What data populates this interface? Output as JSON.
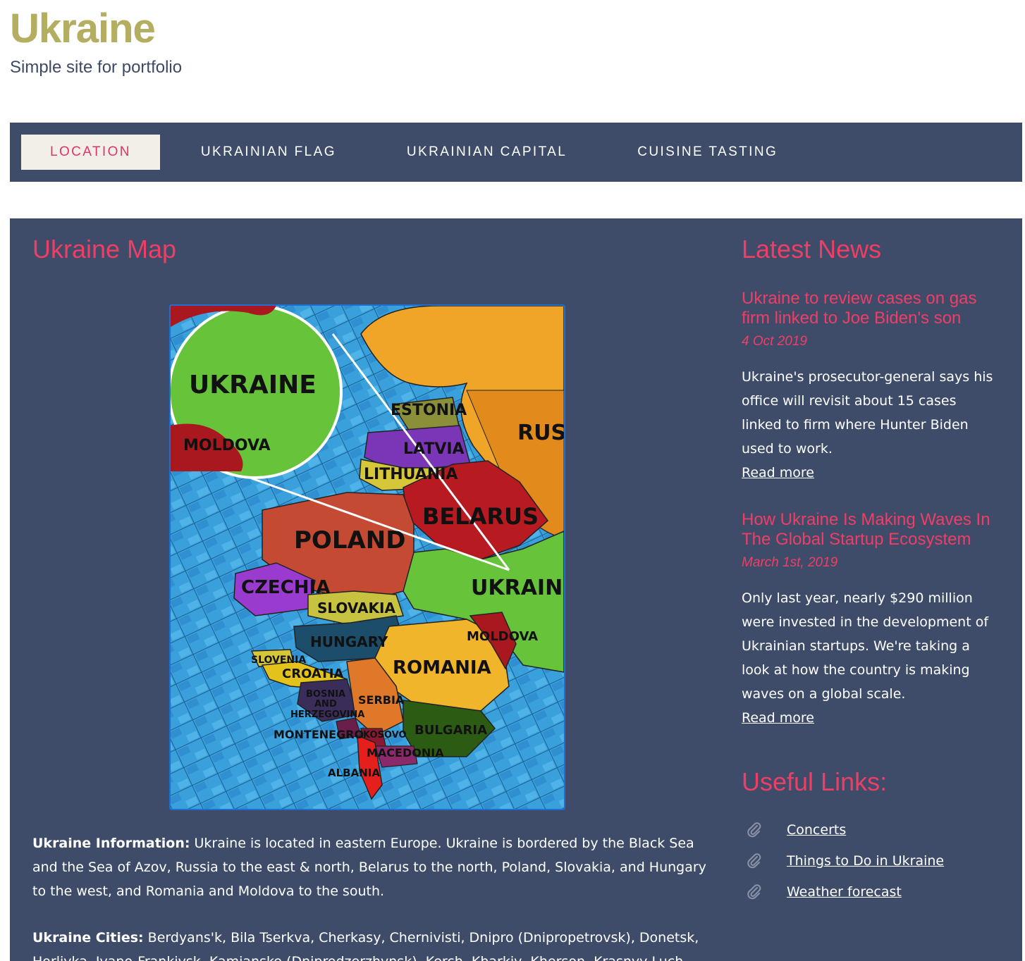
{
  "header": {
    "title": "Ukraine",
    "subtitle": "Simple site for portfolio"
  },
  "nav": {
    "items": [
      {
        "label": "LOCATION",
        "active": true
      },
      {
        "label": "UKRAINIAN FLAG",
        "active": false
      },
      {
        "label": "UKRAINIAN CAPITAL",
        "active": false
      },
      {
        "label": "CUISINE TASTING",
        "active": false
      }
    ]
  },
  "main": {
    "heading": "Ukraine Map",
    "map": {
      "labels": [
        "UKRAINE",
        "MOLDOVA",
        "ESTONIA",
        "RUSS",
        "LATVIA",
        "LITHUANIA",
        "BELARUS",
        "POLAND",
        "CZECHIA",
        "UKRAINE",
        "SLOVAKIA",
        "HUNGARY",
        "MOLDOVA",
        "SLOVENIA",
        "CROATIA",
        "ROMANIA",
        "BOSNIA",
        "AND",
        "HERZEGOVINA",
        "SERBIA",
        "MONTENEGRO",
        "KOSOVO",
        "BULGARIA",
        "MACEDONIA",
        "ALBANIA"
      ]
    },
    "info": {
      "info_label": "Ukraine Information:",
      "info_text": " Ukraine is located in eastern Europe. Ukraine is bordered by the Black Sea and the Sea of Azov, Russia to the east & north, Belarus to the north, Poland, Slovakia, and Hungary to the west, and Romania and Moldova to the south.",
      "cities_label": "Ukraine Cities:",
      "cities_text": " Berdyans'k, Bila Tserkva, Cherkasy, Chernivisti, Dnipro (Dnipropetrovsk), Donetsk, Horlivka, Ivano-Frankivsk, Kamianske (Dniprodzerzhynsk), Kerch, Kharkiv, Kherson, Krasnyy Luch"
    }
  },
  "sidebar": {
    "news_heading": "Latest News",
    "news": [
      {
        "title": "Ukraine to review cases on gas firm linked to Joe Biden's son",
        "date": "4 Oct 2019",
        "body": "Ukraine's prosecutor-general says his office will revisit about 15 cases linked to firm where Hunter Biden used to work.",
        "read_more": "Read more"
      },
      {
        "title": "How Ukraine Is Making Waves In The Global Startup Ecosystem",
        "date": "March 1st, 2019",
        "body": "Only last year, nearly $290 million were invested in the development of Ukrainian startups. We're taking a look at how the country is making waves on a global scale.",
        "read_more": "Read more"
      }
    ],
    "links_heading": "Useful Links:",
    "links": [
      {
        "label": "Concerts",
        "icon": "paperclip-icon"
      },
      {
        "label": "Things to Do in Ukraine",
        "icon": "paperclip-icon"
      },
      {
        "label": "Weather forecast",
        "icon": "paperclip-icon"
      }
    ]
  },
  "colors": {
    "panel": "#3e4c69",
    "accent": "#ef3e66",
    "active_tab_bg": "#f1efe6"
  }
}
